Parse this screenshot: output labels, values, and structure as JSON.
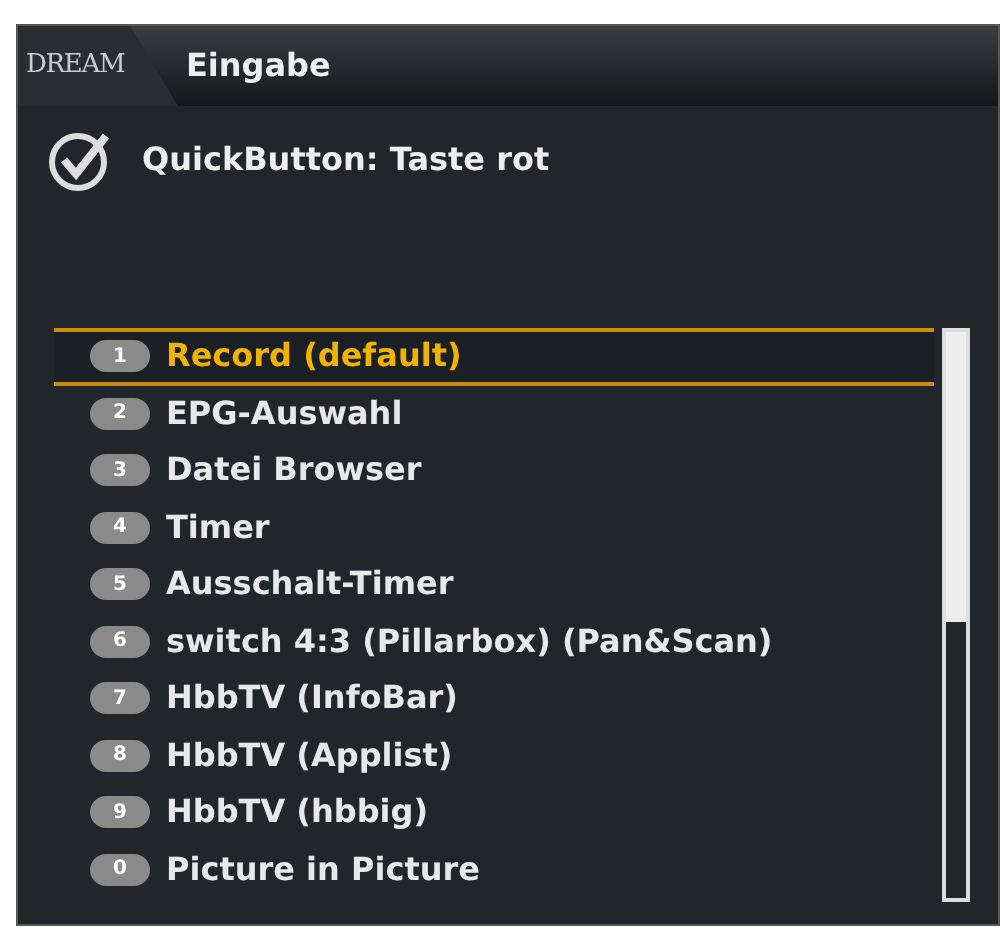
{
  "window": {
    "logo": "DREAM",
    "title": "Eingabe"
  },
  "header": {
    "text": "QuickButton: Taste rot"
  },
  "list": [
    {
      "key": "1",
      "label": "Record (default)",
      "selected": true
    },
    {
      "key": "2",
      "label": "EPG-Auswahl",
      "selected": false
    },
    {
      "key": "3",
      "label": "Datei Browser",
      "selected": false
    },
    {
      "key": "4",
      "label": "Timer",
      "selected": false
    },
    {
      "key": "5",
      "label": "Ausschalt-Timer",
      "selected": false
    },
    {
      "key": "6",
      "label": "switch 4:3 (Pillarbox) (Pan&Scan)",
      "selected": false
    },
    {
      "key": "7",
      "label": "HbbTV (InfoBar)",
      "selected": false
    },
    {
      "key": "8",
      "label": "HbbTV (Applist)",
      "selected": false
    },
    {
      "key": "9",
      "label": "HbbTV (hbbig)",
      "selected": false
    },
    {
      "key": "0",
      "label": "Picture in Picture",
      "selected": false
    }
  ]
}
